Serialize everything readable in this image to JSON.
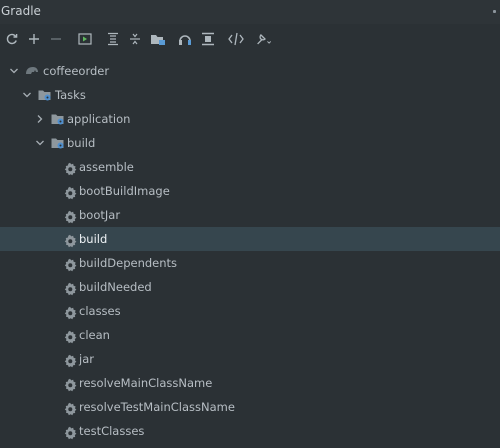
{
  "panel": {
    "title": "Gradle"
  },
  "toolbar": {
    "buttons": [
      {
        "name": "reload-icon"
      },
      {
        "name": "plus-icon"
      },
      {
        "name": "minus-icon"
      },
      {
        "name": "run-task-icon"
      },
      {
        "name": "expand-all-icon"
      },
      {
        "name": "collapse-all-icon"
      },
      {
        "name": "group-modules-icon"
      },
      {
        "name": "offline-mode-icon"
      },
      {
        "name": "toggle-tests-icon"
      },
      {
        "name": "dependencies-icon"
      },
      {
        "name": "settings-wrench-icon"
      }
    ]
  },
  "tree": {
    "project": "coffeeorder",
    "tasks_group": "Tasks",
    "application_group": "application",
    "build_group": "build",
    "selected": "build",
    "build_tasks": [
      "assemble",
      "bootBuildImage",
      "bootJar",
      "build",
      "buildDependents",
      "buildNeeded",
      "classes",
      "clean",
      "jar",
      "resolveMainClassName",
      "resolveTestMainClassName",
      "testClasses"
    ]
  }
}
